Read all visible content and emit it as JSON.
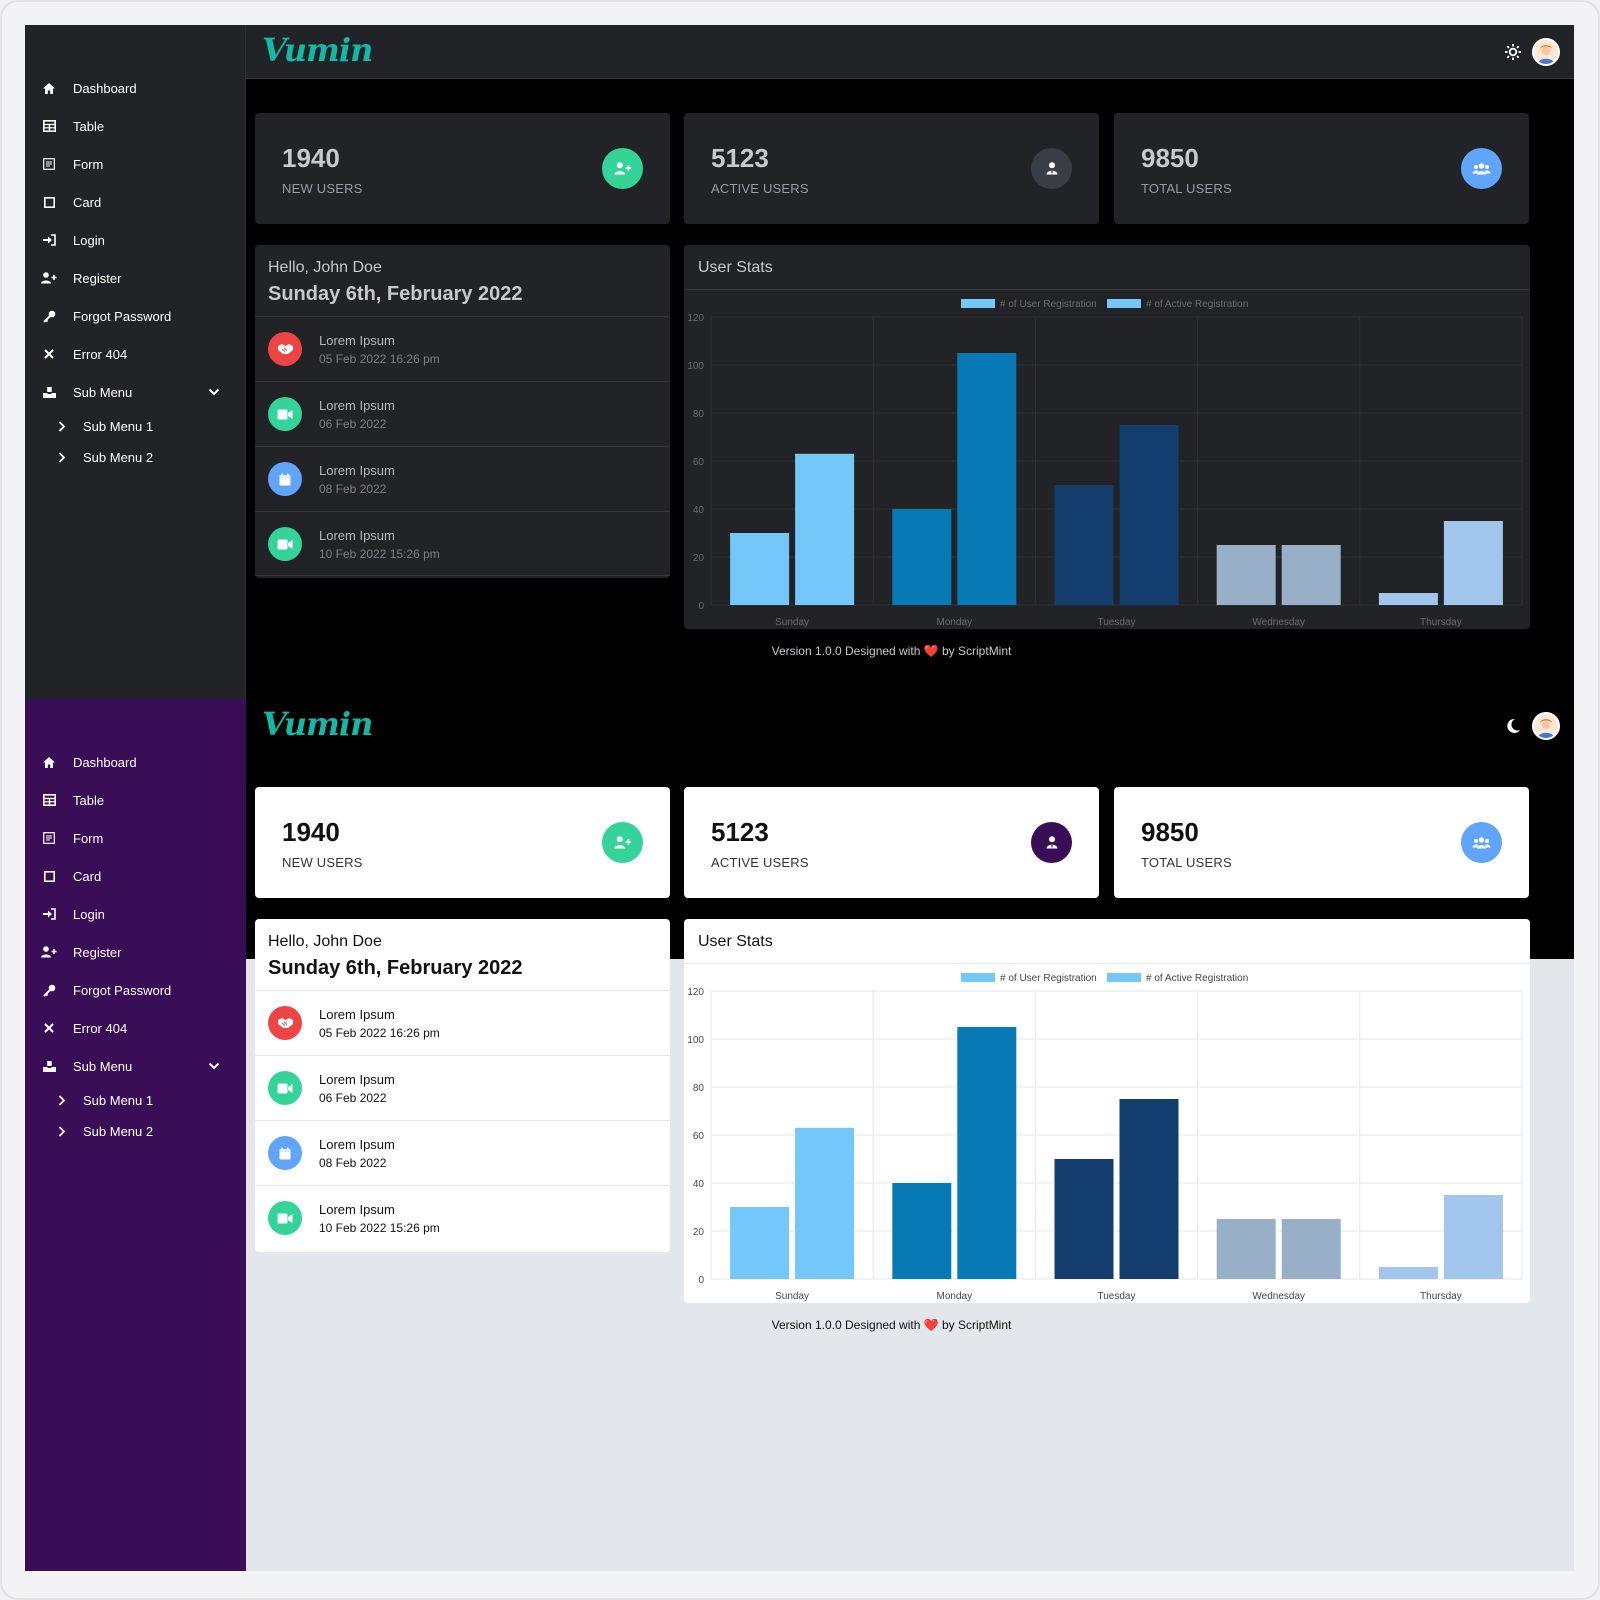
{
  "app": {
    "logo": "Vumin"
  },
  "sidebar": {
    "items": [
      {
        "label": "Dashboard",
        "icon": "home-icon"
      },
      {
        "label": "Table",
        "icon": "table-icon"
      },
      {
        "label": "Form",
        "icon": "form-icon"
      },
      {
        "label": "Card",
        "icon": "card-icon"
      },
      {
        "label": "Login",
        "icon": "login-icon"
      },
      {
        "label": "Register",
        "icon": "user-plus-icon"
      },
      {
        "label": "Forgot Password",
        "icon": "key-icon"
      },
      {
        "label": "Error 404",
        "icon": "close-icon"
      },
      {
        "label": "Sub Menu",
        "icon": "cubes-icon"
      }
    ],
    "sub_items": [
      {
        "label": "Sub Menu 1"
      },
      {
        "label": "Sub Menu 2"
      }
    ]
  },
  "stats": [
    {
      "value": "1940",
      "label": "NEW USERS",
      "color": "#34d399",
      "icon": "user-plus-icon"
    },
    {
      "value": "5123",
      "label": "ACTIVE USERS",
      "color_dark": "#3a3d44",
      "color_light": "#3a0e57",
      "icon": "user-tie-icon"
    },
    {
      "value": "9850",
      "label": "TOTAL USERS",
      "color": "#60a5fa",
      "icon": "users-icon"
    }
  ],
  "welcome": {
    "greeting": "Hello, John Doe",
    "date": "Sunday 6th, February 2022"
  },
  "activities": [
    {
      "title": "Lorem Ipsum",
      "time": "05 Feb 2022 16:26 pm",
      "color": "#ef4444",
      "icon": "handshake-icon"
    },
    {
      "title": "Lorem Ipsum",
      "time": "06 Feb 2022",
      "color": "#34d399",
      "icon": "video-icon"
    },
    {
      "title": "Lorem Ipsum",
      "time": "08 Feb 2022",
      "color": "#60a5fa",
      "icon": "calendar-icon"
    },
    {
      "title": "Lorem Ipsum",
      "time": "10 Feb 2022 15:26 pm",
      "color": "#34d399",
      "icon": "video-icon"
    }
  ],
  "user_stats": {
    "title": "User Stats"
  },
  "chart_data": {
    "type": "bar",
    "categories": [
      "Sunday",
      "Monday",
      "Tuesday",
      "Wednesday",
      "Thursday"
    ],
    "series": [
      {
        "name": "# of User Registration",
        "values": [
          30,
          40,
          50,
          25,
          5
        ]
      },
      {
        "name": "# of Active Registration",
        "values": [
          63,
          105,
          75,
          25,
          35
        ]
      }
    ],
    "bar_colors": [
      [
        "#73c7f9",
        "#73c7f9"
      ],
      [
        "#0779b4",
        "#0779b4"
      ],
      [
        "#133d6d",
        "#133d6d"
      ],
      [
        "#98b0c7",
        "#98b0c7"
      ],
      [
        "#a2c5ec",
        "#a2c5ec"
      ]
    ],
    "legend_color": "#73c7f9",
    "ylim": [
      0,
      120
    ],
    "yticks": [
      0,
      20,
      40,
      60,
      80,
      100,
      120
    ],
    "legend_position": "top"
  },
  "footer": {
    "before": "Version 1.0.0 Designed with ",
    "heart": "❤️",
    "after": " by ScriptMint"
  }
}
